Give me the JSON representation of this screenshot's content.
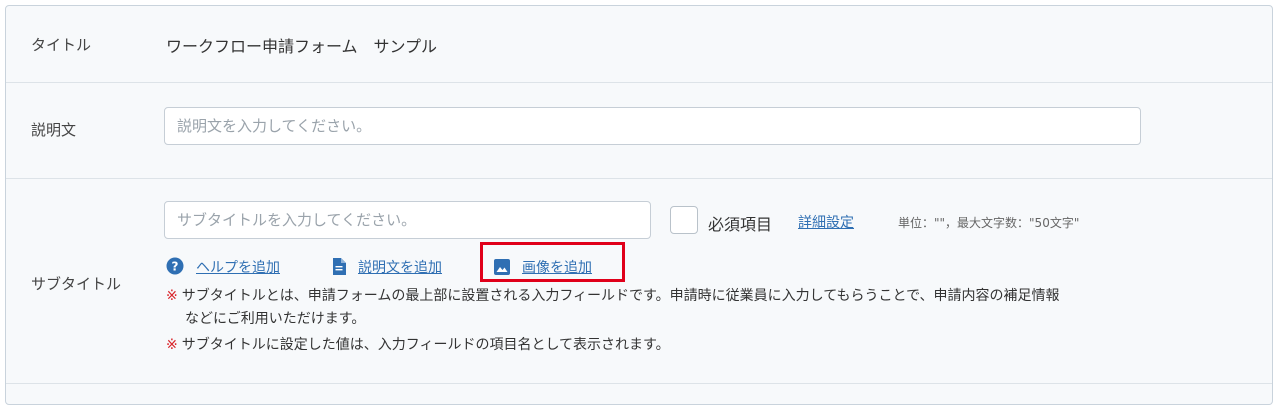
{
  "form": {
    "title_row": {
      "label": "タイトル",
      "value": "ワークフロー申請フォーム　サンプル"
    },
    "description_row": {
      "label": "説明文",
      "placeholder": "説明文を入力してください。"
    },
    "subtitle_row": {
      "label": "サブタイトル",
      "placeholder": "サブタイトルを入力してください。",
      "required_label": "必須項目",
      "required_checked": false,
      "detail_link": "詳細設定",
      "unit_info": "単位：\"\"，最大文字数：\"50文字\"",
      "actions": [
        {
          "label": "ヘルプを追加",
          "icon": "help-circle-icon"
        },
        {
          "label": "説明文を追加",
          "icon": "document-icon"
        },
        {
          "label": "画像を追加",
          "icon": "image-icon"
        }
      ],
      "highlighted_action": "画像を追加",
      "notes": [
        {
          "mark": "※",
          "line1": "サブタイトルとは、申請フォームの最上部に設置される入力フィールドです。申請時に従業員に入力してもらうことで、申請内容の補足情報",
          "line2": "などにご利用いただけます。"
        },
        {
          "mark": "※",
          "line1": "サブタイトルに設定した値は、入力フィールドの項目名として表示されます。"
        }
      ]
    }
  },
  "colors": {
    "link": "#2f6fb3",
    "note_mark": "#d9262c",
    "highlight": "#e0001a",
    "row_bg": "#f7f9fb"
  }
}
